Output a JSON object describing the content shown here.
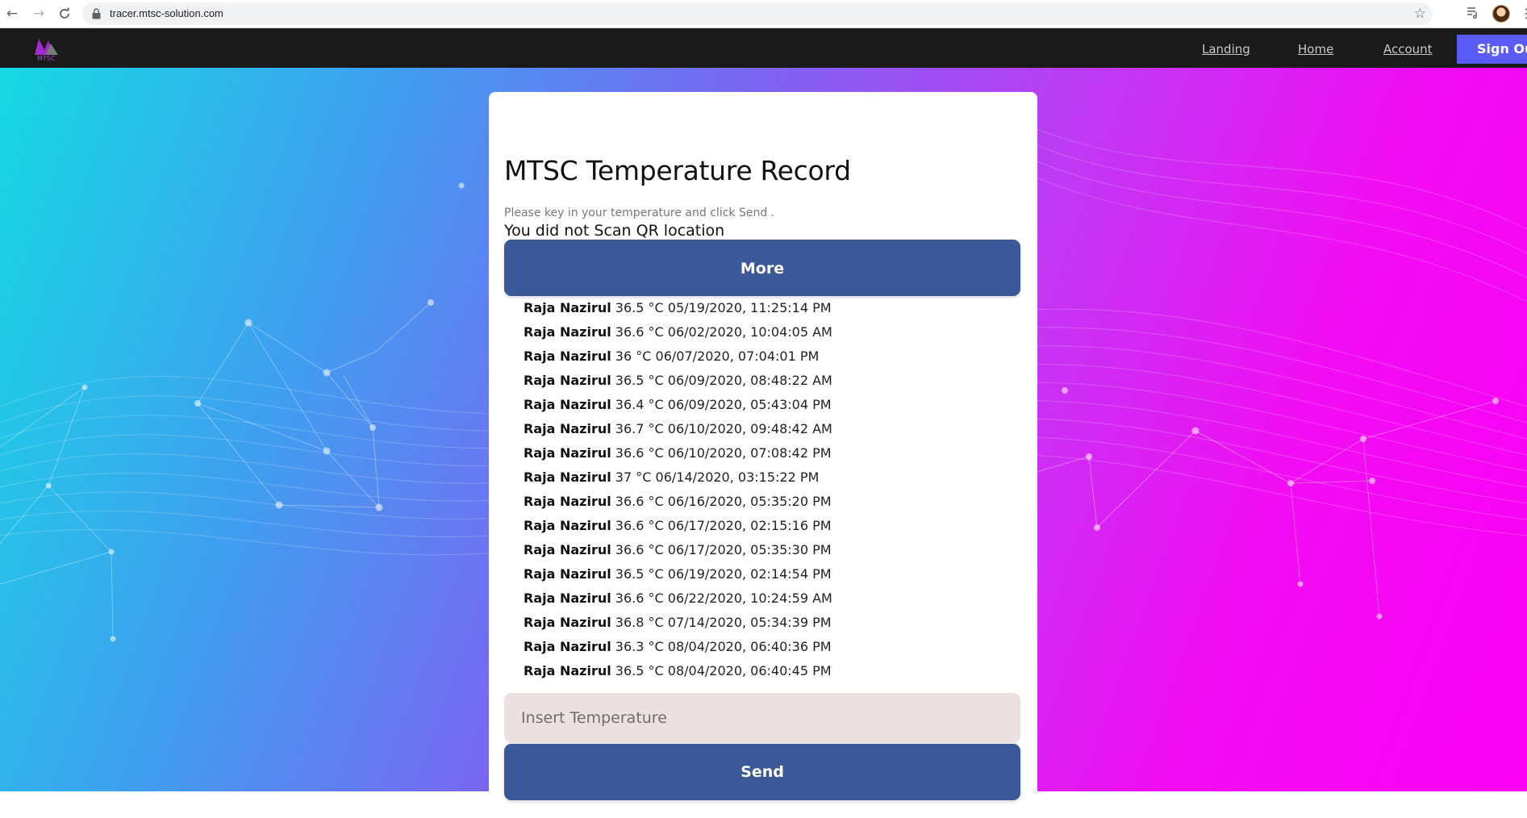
{
  "browser": {
    "url": "tracer.mtsc-solution.com"
  },
  "header": {
    "logo_text": "MTSC",
    "nav": [
      "Landing",
      "Home",
      "Account"
    ],
    "signout_label": "Sign Out"
  },
  "card": {
    "title": "MTSC Temperature Record",
    "instruction": "Please key in your temperature and click Send .",
    "warning": "You did not Scan QR location",
    "more_label": "More",
    "records": [
      {
        "name": "Raja Nazirul",
        "detail": " 36.5 °C 05/19/2020, 11:25:14 PM"
      },
      {
        "name": "Raja Nazirul",
        "detail": " 36.6 °C 06/02/2020, 10:04:05 AM"
      },
      {
        "name": "Raja Nazirul",
        "detail": " 36 °C 06/07/2020, 07:04:01 PM"
      },
      {
        "name": "Raja Nazirul",
        "detail": " 36.5 °C 06/09/2020, 08:48:22 AM"
      },
      {
        "name": "Raja Nazirul",
        "detail": " 36.4 °C 06/09/2020, 05:43:04 PM"
      },
      {
        "name": "Raja Nazirul",
        "detail": " 36.7 °C 06/10/2020, 09:48:42 AM"
      },
      {
        "name": "Raja Nazirul",
        "detail": " 36.6 °C 06/10/2020, 07:08:42 PM"
      },
      {
        "name": "Raja Nazirul",
        "detail": " 37 °C 06/14/2020, 03:15:22 PM"
      },
      {
        "name": "Raja Nazirul",
        "detail": " 36.6 °C 06/16/2020, 05:35:20 PM"
      },
      {
        "name": "Raja Nazirul",
        "detail": " 36.6 °C 06/17/2020, 02:15:16 PM"
      },
      {
        "name": "Raja Nazirul",
        "detail": " 36.6 °C 06/17/2020, 05:35:30 PM"
      },
      {
        "name": "Raja Nazirul",
        "detail": " 36.5 °C 06/19/2020, 02:14:54 PM"
      },
      {
        "name": "Raja Nazirul",
        "detail": " 36.6 °C 06/22/2020, 10:24:59 AM"
      },
      {
        "name": "Raja Nazirul",
        "detail": " 36.8 °C 07/14/2020, 05:34:39 PM"
      },
      {
        "name": "Raja Nazirul",
        "detail": " 36.3 °C 08/04/2020, 06:40:36 PM"
      },
      {
        "name": "Raja Nazirul",
        "detail": " 36.5 °C 08/04/2020, 06:40:45 PM"
      }
    ],
    "input_placeholder": "Insert Temperature",
    "input_value": "",
    "send_label": "Send"
  },
  "colors": {
    "header_bg": "#1a1a1b",
    "signout_bg": "#5b5cf5",
    "button_bg": "#3b5998",
    "input_bg": "#ece1e0",
    "gradient_start": "#16d9e3",
    "gradient_end": "#fa00f5"
  },
  "icons": {
    "back": "arrow-left-icon",
    "forward": "arrow-right-icon",
    "reload": "reload-icon",
    "lock": "lock-icon",
    "bookmark": "star-icon",
    "media": "playlist-icon",
    "profile": "avatar",
    "menu": "kebab-menu-icon"
  }
}
